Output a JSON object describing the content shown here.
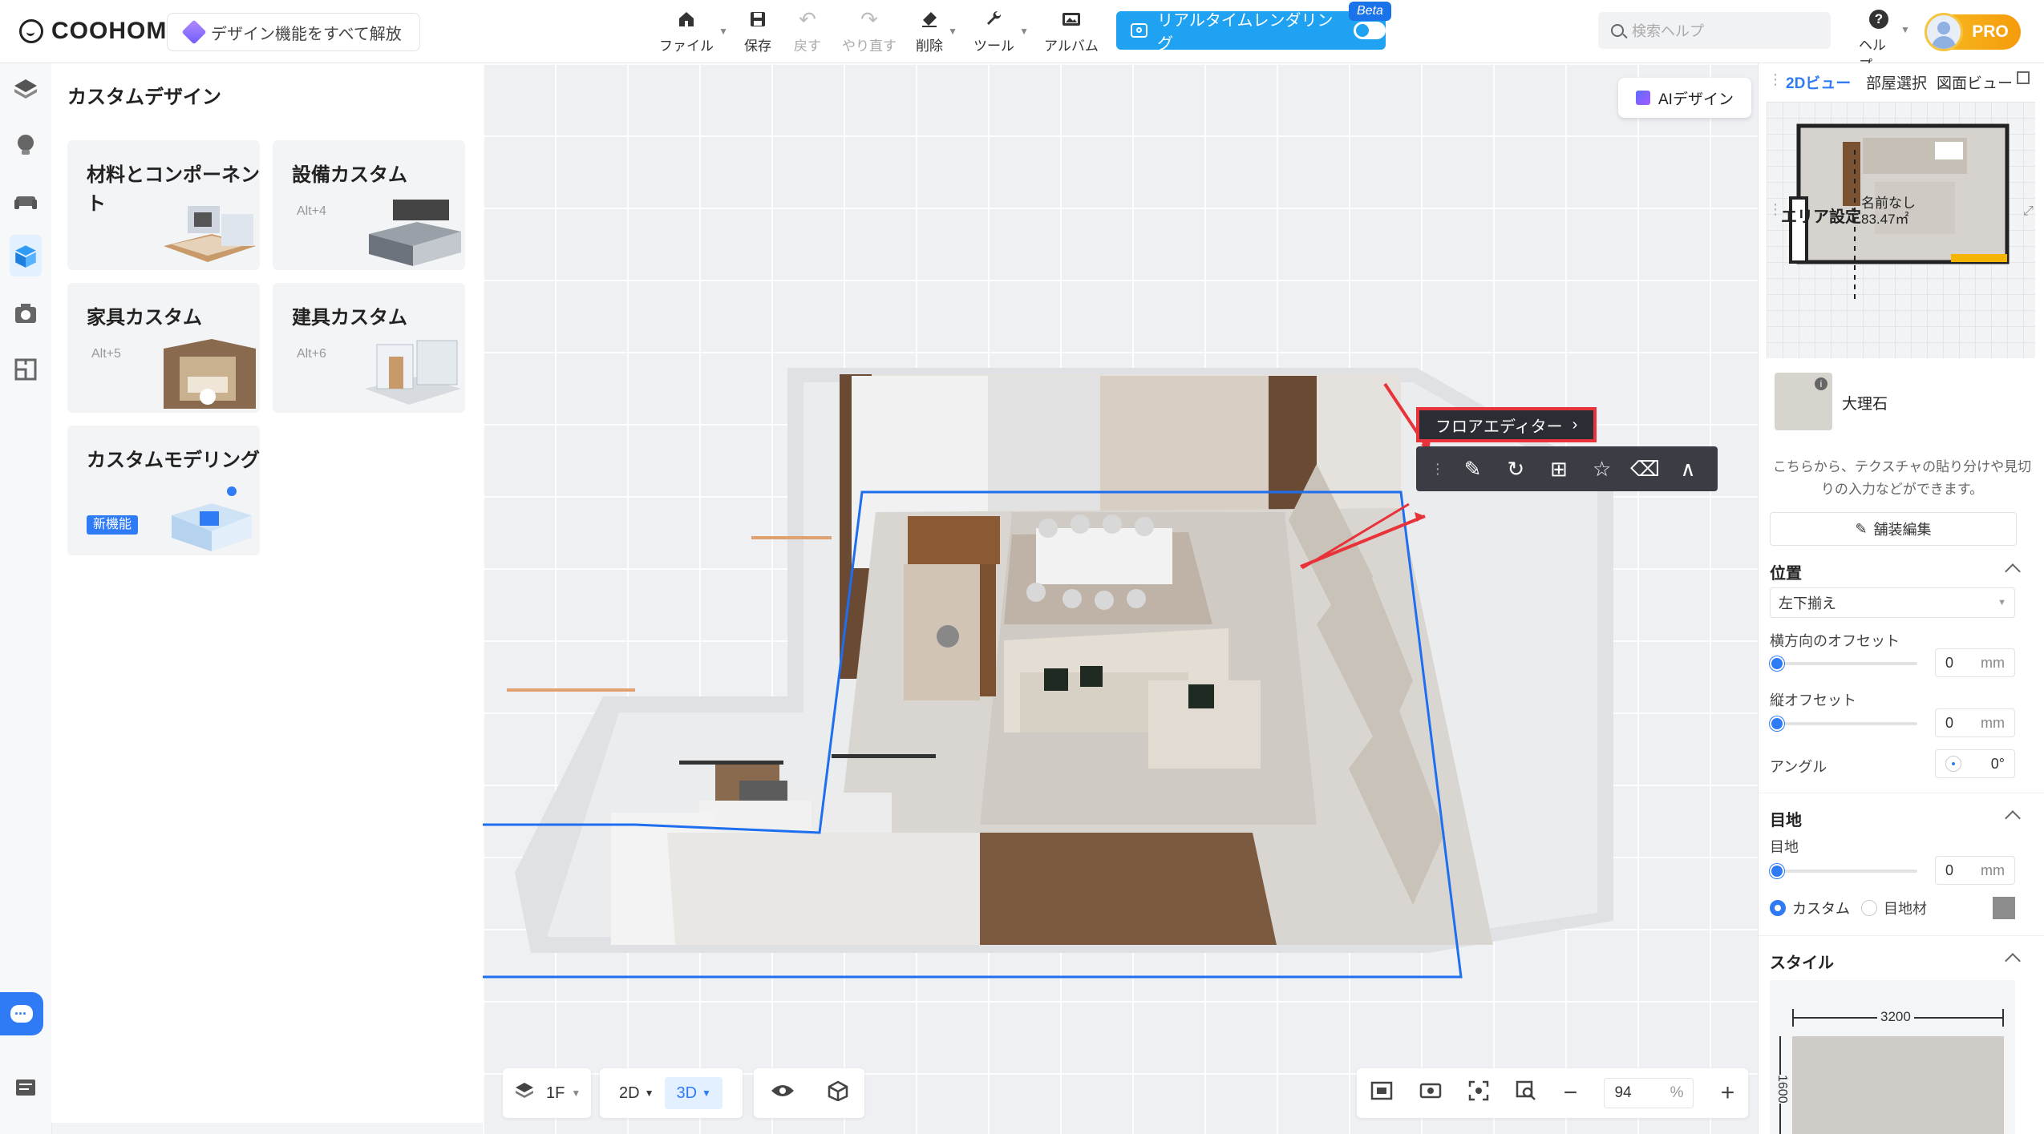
{
  "app": {
    "logo": "COOHOM",
    "unlock_label": "デザイン機能をすべて解放"
  },
  "toolbar": {
    "file": "ファイル",
    "save": "保存",
    "undo": "戻す",
    "redo": "やり直す",
    "delete": "削除",
    "tools": "ツール",
    "album": "アルバム",
    "realtime_render": "リアルタイムレンダリング",
    "beta": "Beta"
  },
  "search": {
    "placeholder": "検索ヘルプ"
  },
  "help": {
    "label": "ヘルプ"
  },
  "account": {
    "plan": "PRO"
  },
  "left_panel": {
    "title": "カスタムデザイン",
    "cards": [
      {
        "title": "材料とコンポーネント",
        "hotkey": "",
        "badge": ""
      },
      {
        "title": "設備カスタム",
        "hotkey": "Alt+4",
        "badge": ""
      },
      {
        "title": "家具カスタム",
        "hotkey": "Alt+5",
        "badge": ""
      },
      {
        "title": "建具カスタム",
        "hotkey": "Alt+6",
        "badge": ""
      },
      {
        "title": "カスタムモデリング",
        "hotkey": "",
        "badge": "新機能"
      }
    ]
  },
  "canvas": {
    "ai_design": "AIデザイン",
    "floor_editor": "フロアエディター",
    "floor_tools": [
      "pencil-icon",
      "rotate-icon",
      "add-copy-icon",
      "star-icon",
      "eraser-icon",
      "smart-icon"
    ]
  },
  "bottom_bar": {
    "floor": "1F",
    "view_2d": "2D",
    "view_3d": "3D",
    "zoom_value": "94",
    "zoom_unit": "%"
  },
  "right_panel": {
    "tabs": [
      "2Dビュー",
      "部屋選択",
      "図面ビュー"
    ],
    "minimap": {
      "room_name": "名前なし",
      "room_area": "83.47㎡"
    },
    "area_settings": {
      "title": "エリア設定",
      "material_name": "大理石",
      "description": "こちらから、テクスチャの貼り分けや見切りの入力などができます。",
      "edit_button": "舗装編集",
      "position": {
        "title": "位置",
        "alignment": "左下揃え",
        "h_offset_label": "横方向のオフセット",
        "h_offset_value": "0",
        "h_offset_unit": "mm",
        "v_offset_label": "縦オフセット",
        "v_offset_value": "0",
        "v_offset_unit": "mm",
        "angle_label": "アングル",
        "angle_value": "0°"
      },
      "joint": {
        "title": "目地",
        "joint_label": "目地",
        "joint_value": "0",
        "joint_unit": "mm",
        "option_custom": "カスタム",
        "option_material": "目地材"
      },
      "style": {
        "title": "スタイル",
        "width": "3200",
        "height": "1600"
      }
    }
  }
}
